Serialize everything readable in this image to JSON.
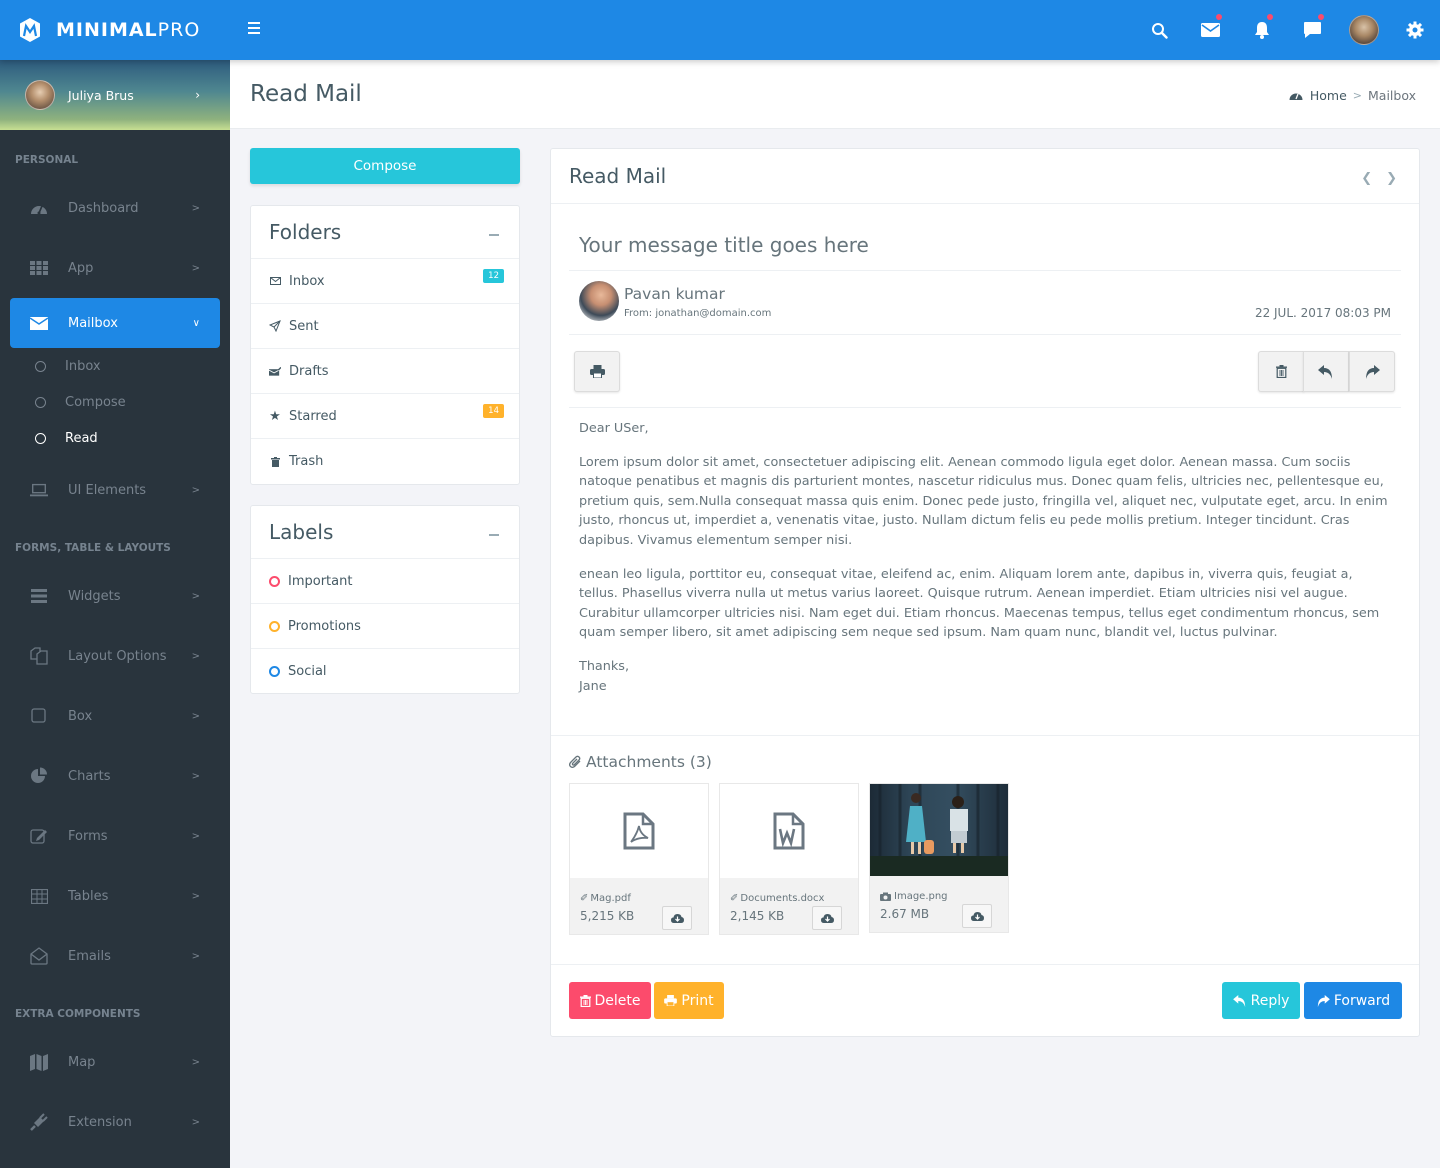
{
  "brand": {
    "name_bold": "MINIMAL",
    "name_light": "PRO"
  },
  "topbar": {
    "icons": [
      {
        "name": "search-icon",
        "dot": false
      },
      {
        "name": "mail-icon",
        "dot": true
      },
      {
        "name": "bell-icon",
        "dot": true
      },
      {
        "name": "chat-icon",
        "dot": true
      },
      {
        "name": "avatar",
        "dot": false
      },
      {
        "name": "gear-icon",
        "dot": false
      }
    ]
  },
  "user": {
    "name": "Juliya Brus"
  },
  "sidebar": {
    "sections": [
      {
        "caption": "PERSONAL"
      },
      {
        "caption": "FORMS, TABLE & LAYOUTS"
      },
      {
        "caption": "EXTRA COMPONENTS"
      }
    ],
    "items": [
      {
        "label": "Dashboard",
        "icon": "dashboard-icon"
      },
      {
        "label": "App",
        "icon": "grid-icon"
      },
      {
        "label": "Mailbox",
        "icon": "envelope-icon",
        "active": true
      },
      {
        "label": "UI Elements",
        "icon": "laptop-icon"
      },
      {
        "label": "Widgets",
        "icon": "bars-icon"
      },
      {
        "label": "Layout Options",
        "icon": "copy-icon"
      },
      {
        "label": "Box",
        "icon": "square-icon"
      },
      {
        "label": "Charts",
        "icon": "pie-chart-icon"
      },
      {
        "label": "Forms",
        "icon": "edit-icon"
      },
      {
        "label": "Tables",
        "icon": "table-icon"
      },
      {
        "label": "Emails",
        "icon": "envelope-open-icon"
      },
      {
        "label": "Map",
        "icon": "map-icon"
      },
      {
        "label": "Extension",
        "icon": "plug-icon"
      }
    ],
    "mailbox_sub": [
      {
        "label": "Inbox"
      },
      {
        "label": "Compose"
      },
      {
        "label": "Read",
        "current": true
      }
    ]
  },
  "header": {
    "title": "Read Mail",
    "breadcrumb": {
      "home": "Home",
      "current": "Mailbox"
    }
  },
  "compose_label": "Compose",
  "folders": {
    "title": "Folders",
    "items": [
      {
        "label": "Inbox",
        "icon": "envelope-icon",
        "badge": "12",
        "badge_color": "#26c6da"
      },
      {
        "label": "Sent",
        "icon": "paper-plane-icon"
      },
      {
        "label": "Drafts",
        "icon": "drafts-icon"
      },
      {
        "label": "Starred",
        "icon": "star-icon",
        "badge": "14",
        "badge_color": "#ffb22b"
      },
      {
        "label": "Trash",
        "icon": "trash-icon"
      }
    ]
  },
  "labels": {
    "title": "Labels",
    "items": [
      {
        "label": "Important",
        "color": "#fc4b6c"
      },
      {
        "label": "Promotions",
        "color": "#ffb22b"
      },
      {
        "label": "Social",
        "color": "#1e88e5"
      }
    ]
  },
  "mail": {
    "box_title": "Read Mail",
    "subject": "Your message title goes here",
    "sender_name": "Pavan kumar",
    "sender_from": "From: jonathan@domain.com",
    "date": "22 JUL. 2017 08:03 PM",
    "greeting": "Dear USer,",
    "paragraphs": [
      "Lorem ipsum dolor sit amet, consectetuer adipiscing elit. Aenean commodo ligula eget dolor. Aenean massa. Cum sociis natoque penatibus et magnis dis parturient montes, nascetur ridiculus mus. Donec quam felis, ultricies nec, pellentesque eu, pretium quis, sem.Nulla consequat massa quis enim. Donec pede justo, fringilla vel, aliquet nec, vulputate eget, arcu. In enim justo, rhoncus ut, imperdiet a, venenatis vitae, justo. Nullam dictum felis eu pede mollis pretium. Integer tincidunt. Cras dapibus. Vivamus elementum semper nisi.",
      "enean leo ligula, porttitor eu, consequat vitae, eleifend ac, enim. Aliquam lorem ante, dapibus in, viverra quis, feugiat a, tellus. Phasellus viverra nulla ut metus varius laoreet. Quisque rutrum. Aenean imperdiet. Etiam ultricies nisi vel augue. Curabitur ullamcorper ultricies nisi. Nam eget dui. Etiam rhoncus. Maecenas tempus, tellus eget condimentum rhoncus, sem quam semper libero, sit amet adipiscing sem neque sed ipsum. Nam quam nunc, blandit vel, luctus pulvinar."
    ],
    "signoff": "Thanks,",
    "signature": "Jane",
    "attachments_title": "Attachments (3)",
    "attachments": [
      {
        "name": "Mag.pdf",
        "size": "5,215 KB",
        "type": "pdf"
      },
      {
        "name": "Documents.docx",
        "size": "2,145 KB",
        "type": "word"
      },
      {
        "name": "Image.png",
        "size": "2.67 MB",
        "type": "image"
      }
    ],
    "buttons": {
      "delete": "Delete",
      "print": "Print",
      "reply": "Reply",
      "forward": "Forward"
    },
    "colors": {
      "delete": "#fc4b6c",
      "print": "#ffb22b",
      "reply": "#26c6da",
      "forward": "#1e88e5"
    }
  }
}
